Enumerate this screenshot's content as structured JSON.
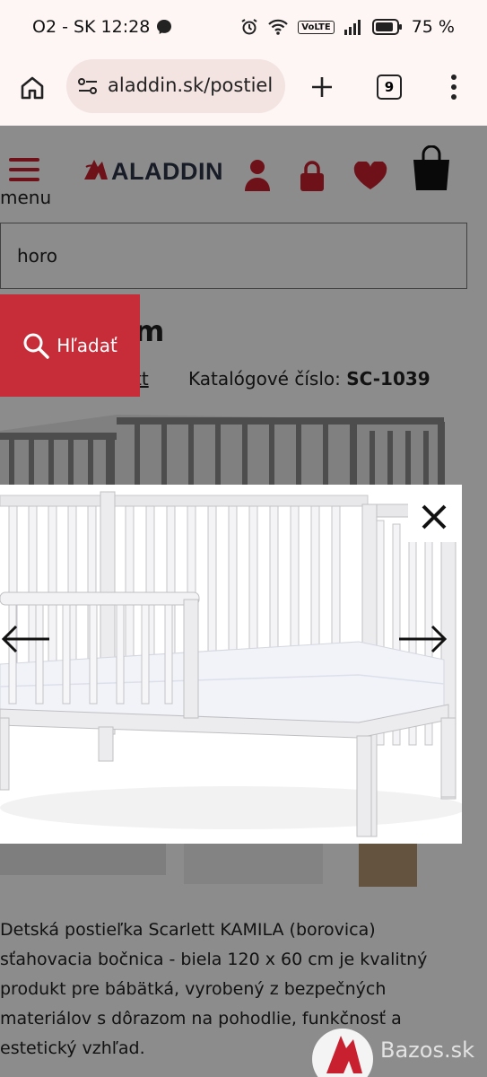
{
  "status_bar": {
    "carrier_time": "O2 - SK 12:28",
    "volte": "VoLTE",
    "battery": "75 %"
  },
  "browser": {
    "url": "aladdin.sk/postiel",
    "tab_count": "9"
  },
  "header": {
    "logo": "ALADDIN",
    "menu_label": "menu"
  },
  "search": {
    "value": "horo",
    "button_label": "Hľadať"
  },
  "product": {
    "title_fragment": "m",
    "brand_fragment": "tt",
    "catalog_label": "Katalógové číslo:",
    "catalog_number": "SC-1039"
  },
  "description": "Detská postieľka Scarlett KAMILA (borovica) sťahovacia bočnica - biela 120 x 60 cm je kvalitný produkt pre bábätká, vyrobený z bezpečných materiálov s dôrazom na pohodlie, funkčnosť a estetický vzhľad.",
  "watermark": "Bazos.sk",
  "colors": {
    "brand_red": "#c8202f",
    "logo_navy": "#2a3348"
  }
}
